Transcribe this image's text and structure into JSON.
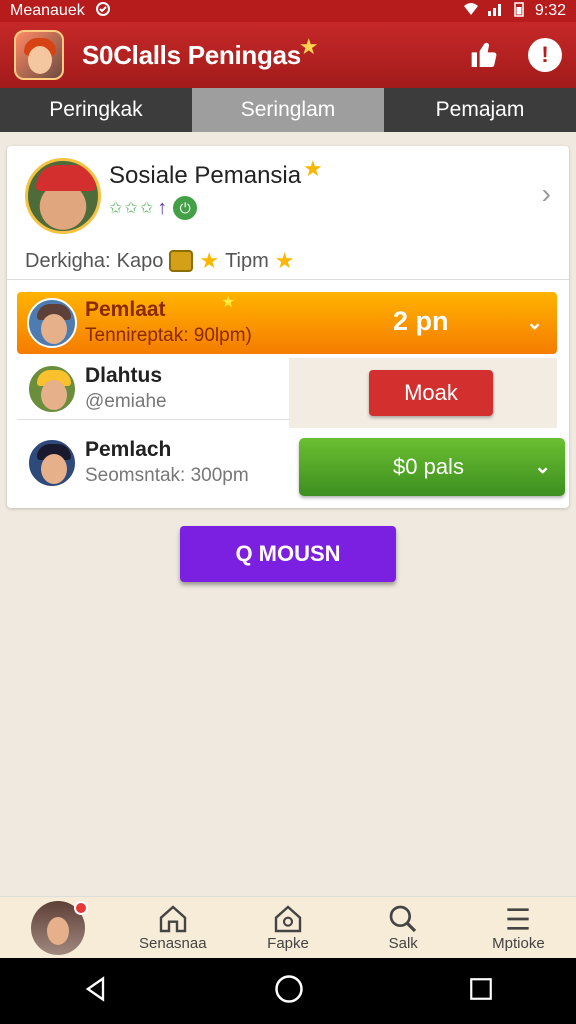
{
  "status_bar": {
    "left_text": "Meanauek",
    "time": "9:32"
  },
  "app_bar": {
    "title": "S0Clalls Peningas"
  },
  "tabs": [
    {
      "label": "Peringkak",
      "active": false
    },
    {
      "label": "Seringlam",
      "active": true
    },
    {
      "label": "Pemajam",
      "active": false
    }
  ],
  "profile": {
    "name": "Sosiale Pemansia",
    "stats_prefix": "Derkigha:",
    "stats_kapo": "Kapo",
    "stats_tipm": "Tipm"
  },
  "rows": [
    {
      "name": "Pemlaat",
      "sub": "Tennireptak: 90lpm)",
      "value": "2 pn"
    },
    {
      "name": "Dlahtus",
      "sub": "@emiahe",
      "action": "Moak"
    },
    {
      "name": "Pemlach",
      "sub": "Seomsntak: 300pm",
      "action": "$0 pals"
    }
  ],
  "main_button": {
    "label": "Q MOUSN"
  },
  "bottom_nav": [
    {
      "label": "Senasnaa",
      "icon": "home-icon"
    },
    {
      "label": "Fapke",
      "icon": "house-badge-icon"
    },
    {
      "label": "Salk",
      "icon": "search-icon"
    },
    {
      "label": "Mptioke",
      "icon": "menu-icon"
    }
  ],
  "colors": {
    "app_bar": "#b71c1c",
    "row_highlight": "#f57c00",
    "danger_button": "#d32f2f",
    "success_button": "#4caf50",
    "primary_button": "#7b1fe0"
  }
}
